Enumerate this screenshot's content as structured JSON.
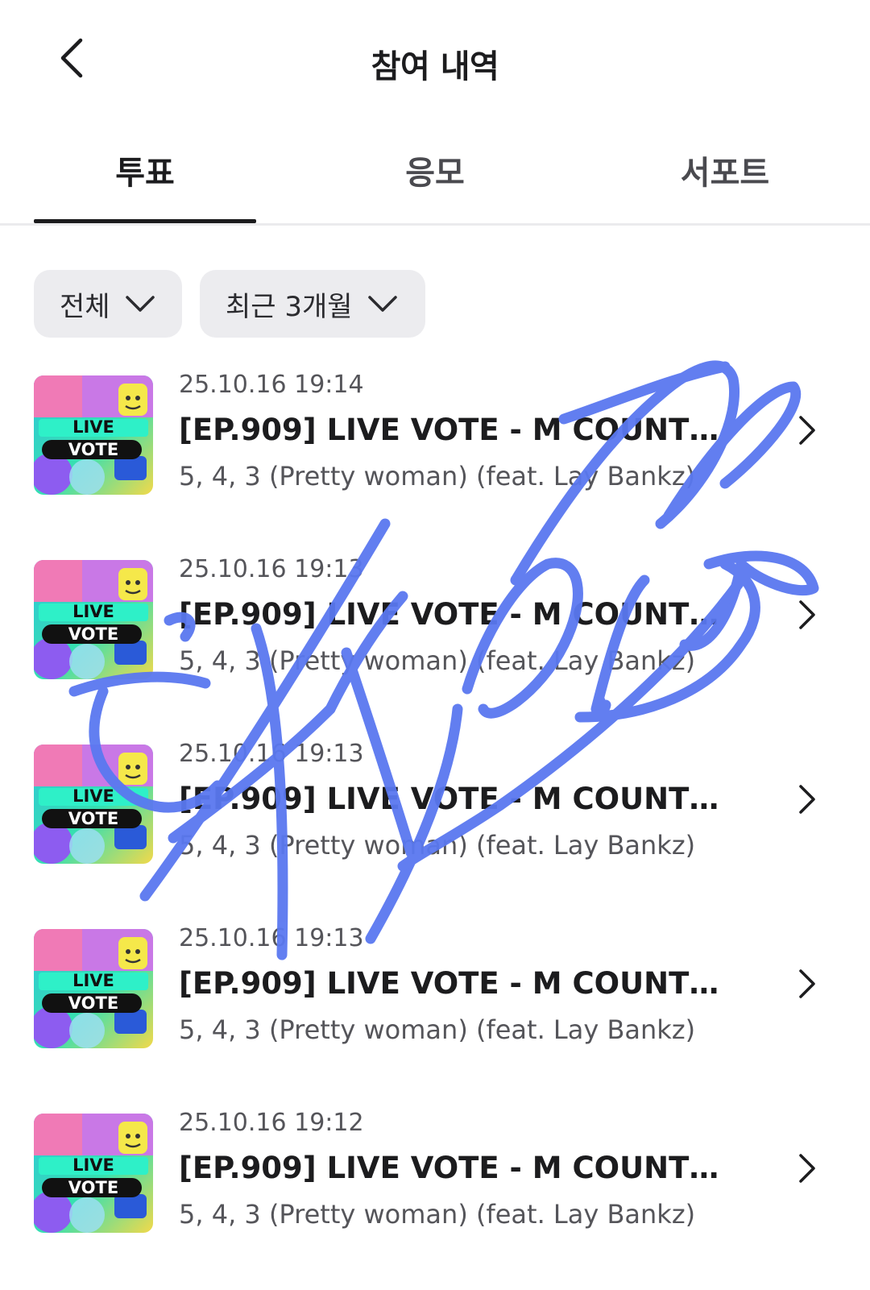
{
  "header": {
    "title": "참여 내역",
    "back_icon": "chevron-left-icon"
  },
  "tabs": [
    {
      "label": "투표",
      "active": true
    },
    {
      "label": "응모",
      "active": false
    },
    {
      "label": "서포트",
      "active": false
    }
  ],
  "filters": [
    {
      "label": "전체",
      "icon": "chevron-down-icon"
    },
    {
      "label": "최근 3개월",
      "icon": "chevron-down-icon"
    }
  ],
  "items": [
    {
      "date": "25.10.16 19:14",
      "title": "[EP.909] LIVE VOTE - M COUNTD...",
      "subtitle": "5, 4, 3 (Pretty woman) (feat. Lay Bankz)",
      "thumb_text_1": "LIVE",
      "thumb_text_2": "VOTE"
    },
    {
      "date": "25.10.16 19:13",
      "title": "[EP.909] LIVE VOTE - M COUNTD...",
      "subtitle": "5, 4, 3 (Pretty woman) (feat. Lay Bankz)",
      "thumb_text_1": "LIVE",
      "thumb_text_2": "VOTE"
    },
    {
      "date": "25.10.16 19:13",
      "title": "[EP.909] LIVE VOTE - M COUNTD...",
      "subtitle": "5, 4, 3 (Pretty woman) (feat. Lay Bankz)",
      "thumb_text_1": "LIVE",
      "thumb_text_2": "VOTE"
    },
    {
      "date": "25.10.16 19:13",
      "title": "[EP.909] LIVE VOTE - M COUNTD...",
      "subtitle": "5, 4, 3 (Pretty woman) (feat. Lay Bankz)",
      "thumb_text_1": "LIVE",
      "thumb_text_2": "VOTE"
    },
    {
      "date": "25.10.16 19:12",
      "title": "[EP.909] LIVE VOTE - M COUNTD...",
      "subtitle": "5, 4, 3 (Pretty woman) (feat. Lay Bankz)",
      "thumb_text_1": "LIVE",
      "thumb_text_2": "VOTE"
    }
  ],
  "colors": {
    "text_primary": "#1c1c1e",
    "text_secondary": "#55555a",
    "filter_bg": "#ececef",
    "scribble": "#5a78f0"
  }
}
